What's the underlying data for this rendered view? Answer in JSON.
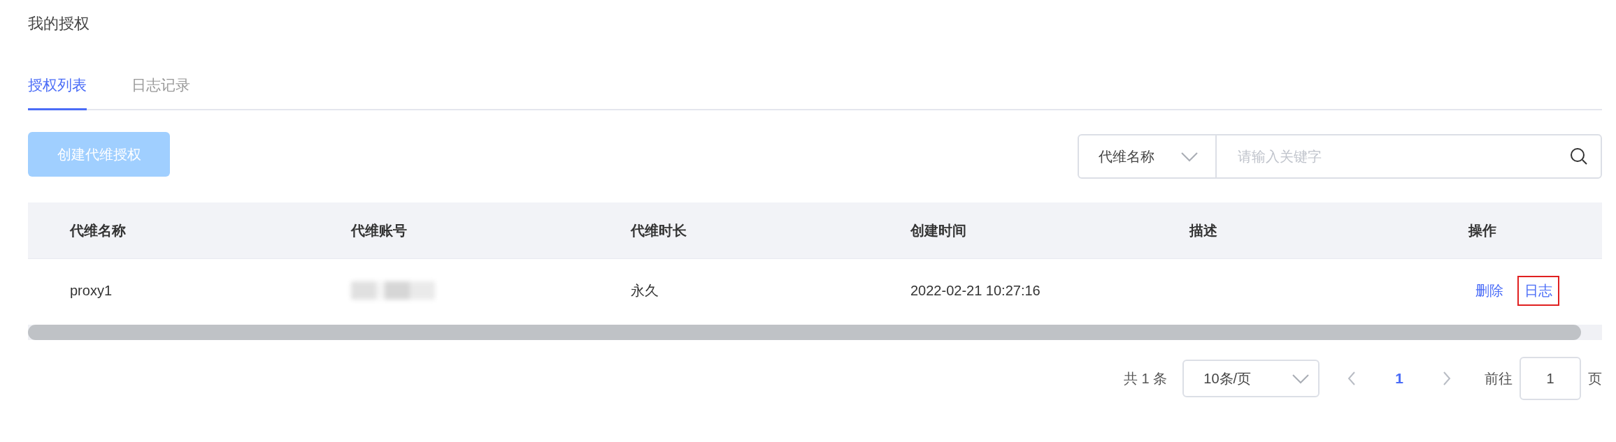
{
  "page_title": "我的授权",
  "tabs": [
    {
      "label": "授权列表",
      "selected": true
    },
    {
      "label": "日志记录",
      "selected": false
    }
  ],
  "create_button": {
    "label": "创建代维授权",
    "disabled": true
  },
  "search": {
    "field_select": "代维名称",
    "placeholder": "请输入关键字"
  },
  "table": {
    "columns": [
      "代维名称",
      "代维账号",
      "代维时长",
      "创建时间",
      "描述",
      "操作"
    ],
    "rows": [
      {
        "cells": [
          "proxy1",
          "",
          "永久",
          "2022-02-21 10:27:16",
          ""
        ],
        "account_blurred": true,
        "actions": [
          {
            "label": "删除",
            "highlighted": false
          },
          {
            "label": "日志",
            "highlighted": true
          }
        ]
      }
    ]
  },
  "pagination": {
    "total": "共 1 条",
    "page_size": "10条/页",
    "pages": [
      {
        "label": "1",
        "selected": true
      }
    ],
    "goto_label": "前往",
    "goto_value": "1",
    "goto_suffix": "页"
  }
}
